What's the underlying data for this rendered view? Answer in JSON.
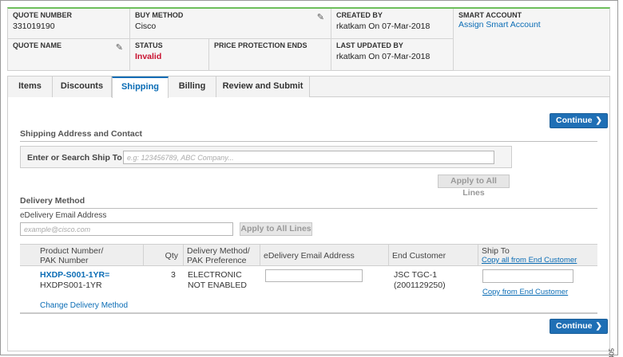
{
  "header": {
    "quote_number_label": "QUOTE NUMBER",
    "quote_number": "331019190",
    "buy_method_label": "BUY METHOD",
    "buy_method": "Cisco",
    "created_by_label": "CREATED BY",
    "created_by": "rkatkam On 07-Mar-2018",
    "smart_account_label": "SMART ACCOUNT",
    "smart_account_link": "Assign Smart Account",
    "quote_name_label": "QUOTE NAME",
    "status_label": "STATUS",
    "status": "Invalid",
    "price_protection_label": "PRICE PROTECTION ENDS",
    "last_updated_label": "LAST UPDATED BY",
    "last_updated": "rkatkam On 07-Mar-2018"
  },
  "tabs": [
    "Items",
    "Discounts",
    "Shipping",
    "Billing",
    "Review and Submit"
  ],
  "active_tab": "Shipping",
  "continue_label": "Continue",
  "shipping": {
    "section_title": "Shipping Address and Contact",
    "ship_to_label": "Enter or Search Ship To",
    "ship_to_placeholder": "e.g: 123456789, ABC Company...",
    "apply_all_label": "Apply to All Lines"
  },
  "delivery": {
    "section_title": "Delivery Method",
    "email_label": "eDelivery Email Address",
    "email_placeholder": "example@cisco.com",
    "apply_all_label": "Apply to All Lines"
  },
  "table": {
    "headers": {
      "product": "Product Number/\nPAK Number",
      "product_l1": "Product Number/",
      "product_l2": "PAK Number",
      "qty": "Qty",
      "method_l1": "Delivery Method/",
      "method_l2": "PAK Preference",
      "email": "eDelivery Email Address",
      "end_customer": "End Customer",
      "ship_to": "Ship To",
      "copy_all": "Copy all from End Customer"
    },
    "row": {
      "product_number": "HXDP-S001-1YR=",
      "pak_number": "HXDPS001-1YR",
      "qty": "3",
      "method_l1": "ELECTRONIC",
      "method_l2": "NOT ENABLED",
      "email_value": "",
      "end_customer_l1": "JSC TGC-1",
      "end_customer_l2": "(2001129250)",
      "copy_from": "Copy from End Customer",
      "change_delivery": "Change Delivery Method"
    }
  },
  "figure_id": "366405"
}
